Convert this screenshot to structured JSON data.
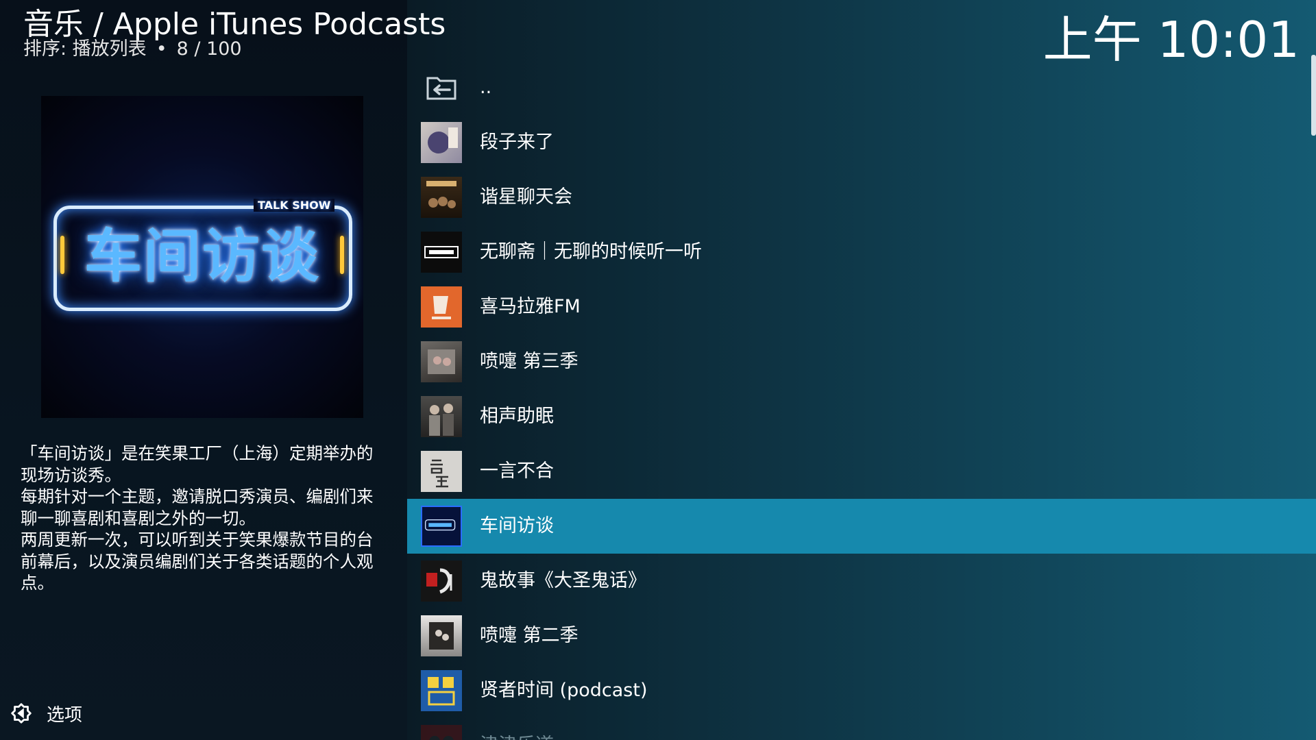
{
  "header": {
    "path": "音乐 / Apple iTunes Podcasts",
    "sort_label": "排序: 播放列表",
    "position": "8 / 100",
    "clock": "上午 10:01"
  },
  "poster": {
    "tag": "TALK SHOW",
    "title": "车间访谈"
  },
  "description": "「车间访谈」是在笑果工厂（上海）定期举办的现场访谈秀。\n每期针对一个主题，邀请脱口秀演员、编剧们来聊一聊喜剧和喜剧之外的一切。\n两周更新一次，可以听到关于笑果爆款节目的台前幕后，以及演员编剧们关于各类话题的个人观点。",
  "options": {
    "label": "选项",
    "icon": "options-gear-icon"
  },
  "list": {
    "items": [
      {
        "label": "..",
        "icon": "back-folder-icon"
      },
      {
        "label": "段子来了"
      },
      {
        "label": "谐星聊天会"
      },
      {
        "label": "无聊斋｜无聊的时候听一听"
      },
      {
        "label": "喜马拉雅FM"
      },
      {
        "label": "喷嚏 第三季"
      },
      {
        "label": "相声助眠"
      },
      {
        "label": "一言不合"
      },
      {
        "label": "车间访谈",
        "selected": true
      },
      {
        "label": "鬼故事《大圣鬼话》"
      },
      {
        "label": "喷嚏 第二季"
      },
      {
        "label": "贤者时间 (podcast)"
      },
      {
        "label": "津津乐道"
      }
    ]
  },
  "colors": {
    "selection": "#1689ad",
    "background_dark": "#070d12",
    "background_accent": "#145a72"
  }
}
